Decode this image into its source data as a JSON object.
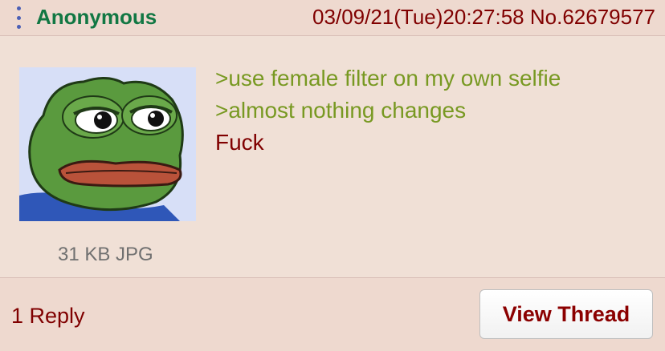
{
  "post": {
    "name": "Anonymous",
    "date": "03/09/21(Tue)20:27:58",
    "number": "No.62679577",
    "menu_icon": "vertical-dots-icon",
    "lines": [
      {
        "type": "quote",
        "text": ">use female filter on my own selfie"
      },
      {
        "type": "quote",
        "text": ">almost nothing changes"
      },
      {
        "type": "plain",
        "text": "Fuck"
      }
    ],
    "file_info": "31 KB JPG",
    "colors": {
      "name": "#117743",
      "quote": "#789922",
      "text": "#800000",
      "background": "#f0e0d6"
    }
  },
  "footer": {
    "replies": "1 Reply",
    "view_thread": "View Thread"
  }
}
